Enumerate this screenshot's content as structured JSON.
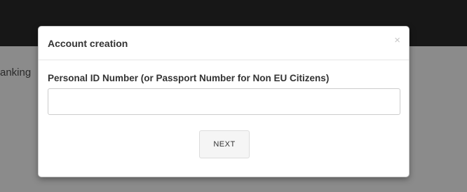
{
  "background": {
    "partial_text": "anking"
  },
  "modal": {
    "title": "Account creation",
    "close_label": "×",
    "field_label": "Personal ID Number (or Passport Number for Non EU Citizens)",
    "input_value": "",
    "input_placeholder": "",
    "next_label": "NEXT"
  }
}
